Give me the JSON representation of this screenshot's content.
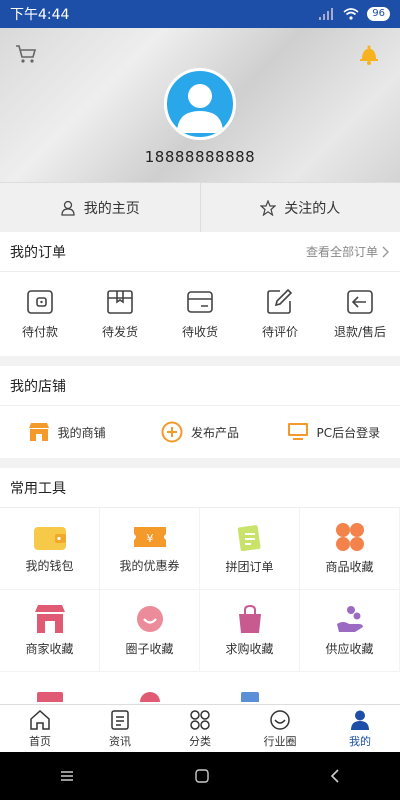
{
  "status_bar": {
    "time": "下午4:44",
    "battery": "96"
  },
  "header": {
    "phone": "18888888888"
  },
  "home_tabs": [
    {
      "label": "我的主页",
      "icon": "person-icon"
    },
    {
      "label": "关注的人",
      "icon": "star-icon"
    }
  ],
  "orders": {
    "title": "我的订单",
    "view_all": "查看全部订单",
    "items": [
      {
        "label": "待付款",
        "icon": "wallet-outline-icon"
      },
      {
        "label": "待发货",
        "icon": "box-icon"
      },
      {
        "label": "待收货",
        "icon": "card-receive-icon"
      },
      {
        "label": "待评价",
        "icon": "edit-icon"
      },
      {
        "label": "退款/售后",
        "icon": "return-icon"
      }
    ]
  },
  "shop": {
    "title": "我的店铺",
    "items": [
      {
        "label": "我的商铺",
        "icon": "store-icon"
      },
      {
        "label": "发布产品",
        "icon": "plus-circle-icon"
      },
      {
        "label": "PC后台登录",
        "icon": "monitor-icon"
      }
    ]
  },
  "tools": {
    "title": "常用工具",
    "items": [
      {
        "label": "我的钱包",
        "icon": "wallet-icon"
      },
      {
        "label": "我的优惠券",
        "icon": "coupon-icon"
      },
      {
        "label": "拼团订单",
        "icon": "group-order-icon"
      },
      {
        "label": "商品收藏",
        "icon": "clover-icon"
      },
      {
        "label": "商家收藏",
        "icon": "shop-awning-icon"
      },
      {
        "label": "圈子收藏",
        "icon": "smile-circle-icon"
      },
      {
        "label": "求购收藏",
        "icon": "bag-icon"
      },
      {
        "label": "供应收藏",
        "icon": "supply-hand-icon"
      }
    ]
  },
  "tabbar": [
    {
      "label": "首页",
      "icon": "home-icon",
      "active": false
    },
    {
      "label": "资讯",
      "icon": "news-icon",
      "active": false
    },
    {
      "label": "分类",
      "icon": "category-icon",
      "active": false
    },
    {
      "label": "行业圈",
      "icon": "circle-icon",
      "active": false
    },
    {
      "label": "我的",
      "icon": "user-icon",
      "active": true
    }
  ],
  "colors": {
    "primary": "#1e4fa8",
    "orange": "#f39a2b",
    "pink": "#e0708a",
    "purple": "#9b6bc4",
    "yellow": "#f7c948"
  }
}
